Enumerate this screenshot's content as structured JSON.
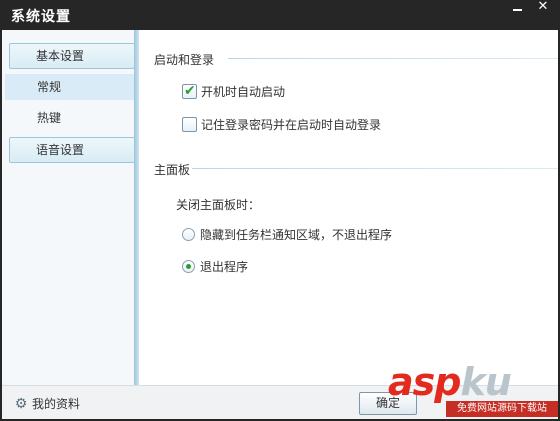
{
  "window": {
    "title": "系统设置",
    "minimize_label": "—",
    "close_label": "✕"
  },
  "sidebar": {
    "items": [
      {
        "label": "基本设置",
        "kind": "group"
      },
      {
        "label": "常规",
        "kind": "item",
        "active": true
      },
      {
        "label": "热键",
        "kind": "item",
        "active": false
      },
      {
        "label": "语音设置",
        "kind": "group"
      }
    ]
  },
  "main": {
    "sections": [
      {
        "title": "启动和登录",
        "options": [
          {
            "label": "开机时自动启动",
            "checked": true
          },
          {
            "label": "记住登录密码并在启动时自动登录",
            "checked": false
          }
        ]
      },
      {
        "title": "主面板",
        "subtitle": "关闭主面板时：",
        "radios": [
          {
            "label": "隐藏到任务栏通知区域，不退出程序",
            "selected": false
          },
          {
            "label": "退出程序",
            "selected": true
          }
        ]
      }
    ]
  },
  "footer": {
    "profile_label": "我的资料",
    "ok_label": "确定"
  },
  "watermark": {
    "brand_asp": "asp",
    "brand_ku": "ku",
    "tagline": "免费网站源码下载站"
  },
  "colors": {
    "titlebar": "#262626",
    "accent_check": "#2f9a2f",
    "watermark_red": "#e32a1f"
  }
}
